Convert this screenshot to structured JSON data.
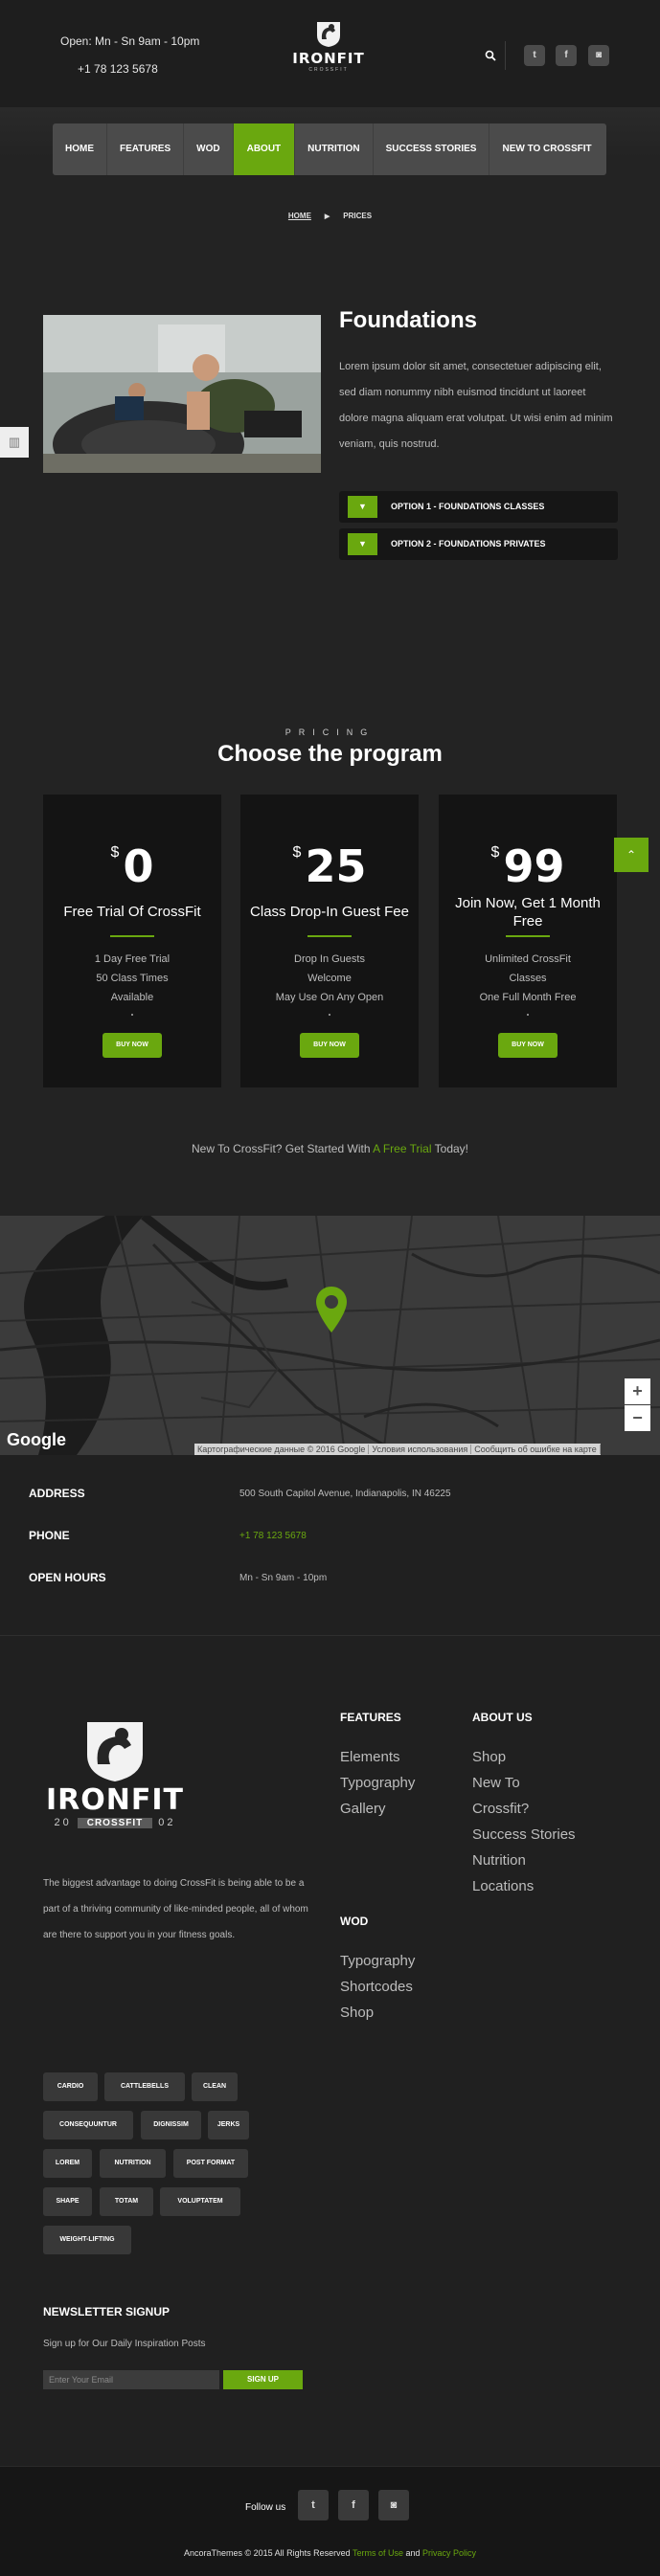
{
  "header": {
    "open_hours": "Open: Mn - Sn 9am - 10pm",
    "phone": "+1 78 123 5678",
    "logo_word": "IRONFIT",
    "logo_sub": "CROSSFIT",
    "social": [
      "t",
      "f",
      "◙"
    ]
  },
  "nav": {
    "items": [
      "HOME",
      "FEATURES",
      "WOD",
      "ABOUT",
      "NUTRITION",
      "SUCCESS STORIES",
      "NEW TO CROSSFIT"
    ],
    "active": "ABOUT"
  },
  "breadcrumb": {
    "home": "HOME",
    "current": "PRICES"
  },
  "foundations": {
    "title": "Foundations",
    "text": "Lorem ipsum dolor sit amet, consectetuer adipiscing elit, sed diam nonummy nibh euismod tincidunt ut laoreet dolore magna aliquam erat volutpat. Ut wisi enim ad minim veniam, quis nostrud.",
    "options": [
      "OPTION 1 - FOUNDATIONS CLASSES",
      "OPTION 2 - FOUNDATIONS PRIVATES"
    ]
  },
  "pricing": {
    "eyebrow": "PRICING",
    "title": "Choose the program",
    "currency": "$",
    "buy_label": "BUY NOW",
    "plans": [
      {
        "price": "0",
        "title": "Free Trial Of CrossFit",
        "features": [
          "1 Day Free Trial",
          "50 Class Times",
          "Available"
        ]
      },
      {
        "price": "25",
        "title": "Class Drop-In Guest Fee",
        "features": [
          "Drop In Guests",
          "Welcome",
          "May Use On Any Open"
        ]
      },
      {
        "price": "99",
        "title": "Join Now, Get 1 Month Free",
        "features": [
          "Unlimited CrossFit",
          "Classes",
          "One Full Month Free"
        ]
      }
    ],
    "cta_before": "New To CrossFit? Get Started With ",
    "cta_link": "A Free Trial",
    "cta_after": " Today!"
  },
  "map": {
    "google": "Google",
    "attribution": [
      "Картографические данные © 2016 Google",
      "Условия использования",
      "Сообщить об ошибке на карте"
    ],
    "zoom_in": "+",
    "zoom_out": "−"
  },
  "contact": {
    "address_label": "ADDRESS",
    "address": "500 South Capitol Avenue, Indianapolis, IN 46225",
    "phone_label": "PHONE",
    "phone": "+1 78 123 5678",
    "hours_label": "OPEN HOURS",
    "hours": "Mn - Sn 9am - 10pm"
  },
  "footer": {
    "logo_word": "IRONFIT",
    "logo_year_left": "20",
    "logo_ribbon": "CROSSFIT",
    "logo_year_right": "02",
    "about": "The biggest advantage to doing CrossFit is being able to be a part of a thriving community of like-minded people, all of whom are there to support you in your fitness goals.",
    "features_heading": "FEATURES",
    "features_links": [
      "Elements",
      "Typography",
      "Gallery"
    ],
    "about_heading": "ABOUT US",
    "about_links": [
      "Shop",
      "New To",
      "Crossfit?",
      "Success Stories",
      "Nutrition",
      "Locations"
    ],
    "wod_heading": "WOD",
    "wod_links": [
      "Typography",
      "Shortcodes",
      "Shop"
    ],
    "tags": [
      "CARDIO",
      "CATTLEBELLS",
      "CLEAN",
      "CONSEQUUNTUR",
      "DIGNISSIM",
      "JERKS",
      "LOREM",
      "NUTRITION",
      "POST FORMAT",
      "SHAPE",
      "TOTAM",
      "VOLUPTATEM",
      "WEIGHT-LIFTING"
    ],
    "newsletter_title": "NEWSLETTER SIGNUP",
    "newsletter_sub": "Sign up for Our Daily Inspiration Posts",
    "newsletter_placeholder": "Enter Your Email",
    "newsletter_button": "SIGN UP"
  },
  "bottom": {
    "follow": "Follow us",
    "social": [
      "t",
      "f",
      "◙"
    ],
    "brand": "AncoraThemes",
    "copy_mid": " © 2015 All Rights Reserved ",
    "terms": "Terms of Use",
    "and": " and ",
    "privacy": "Privacy Policy"
  },
  "colors": {
    "accent": "#6aa80f",
    "background": "#232323",
    "card": "#141414",
    "nav": "#4b4b4b"
  }
}
